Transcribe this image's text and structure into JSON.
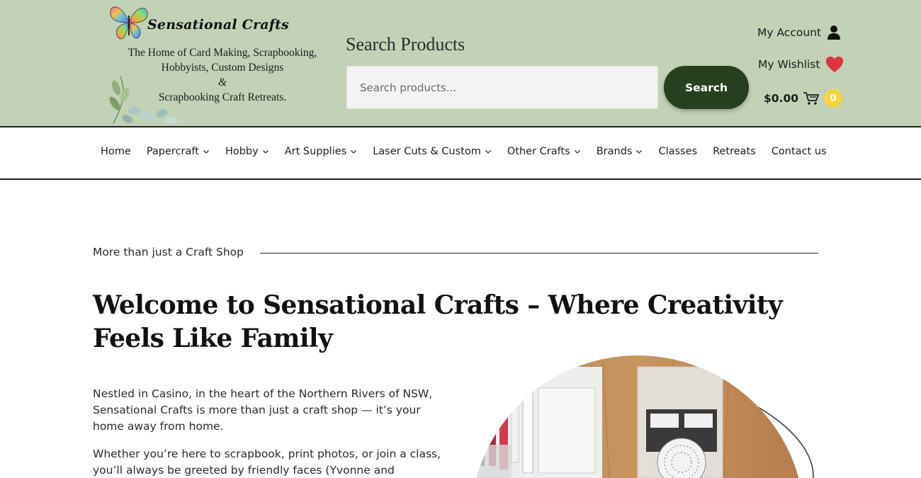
{
  "brand": {
    "name": "Sensational Crafts",
    "tagline_lines": [
      "The Home of Card Making, Scrapbooking,",
      "Hobbyists, Custom Designs",
      "&",
      "Scrapbooking Craft Retreats."
    ]
  },
  "search": {
    "title": "Search Products",
    "placeholder": "Search products...",
    "button_label": "Search"
  },
  "account": {
    "my_account_label": "My Account",
    "my_wishlist_label": "My Wishlist",
    "cart_total": "$0.00",
    "cart_count": "0"
  },
  "nav": {
    "items": [
      {
        "label": "Home",
        "dropdown": false
      },
      {
        "label": "Papercraft",
        "dropdown": true
      },
      {
        "label": "Hobby",
        "dropdown": true
      },
      {
        "label": "Art Supplies",
        "dropdown": true
      },
      {
        "label": "Laser Cuts & Custom",
        "dropdown": true
      },
      {
        "label": "Other Crafts",
        "dropdown": true
      },
      {
        "label": "Brands",
        "dropdown": true
      },
      {
        "label": "Classes",
        "dropdown": false
      },
      {
        "label": "Retreats",
        "dropdown": false
      },
      {
        "label": "Contact us",
        "dropdown": false
      }
    ]
  },
  "main": {
    "eyebrow": "More than just a Craft Shop",
    "headline": "Welcome to Sensational Crafts – Where Creativity Feels Like Family",
    "paragraph1": "Nestled in Casino, in the heart of the Northern Rivers of NSW, Sensational Crafts is more than just a craft shop — it’s your home away from home.",
    "paragraph2": "Whether you’re here to scrapbook, print photos, or join a class, you’ll always be greeted by friendly faces (Yvonne and"
  },
  "colors": {
    "header_bg": "#c2d2b6",
    "search_button": "#26401f",
    "heart": "#e0313f",
    "cart_badge": "#f5d33b"
  },
  "icons": [
    "butterfly-logo-icon",
    "user-icon",
    "heart-icon",
    "cart-icon",
    "chevron-down-icon"
  ]
}
